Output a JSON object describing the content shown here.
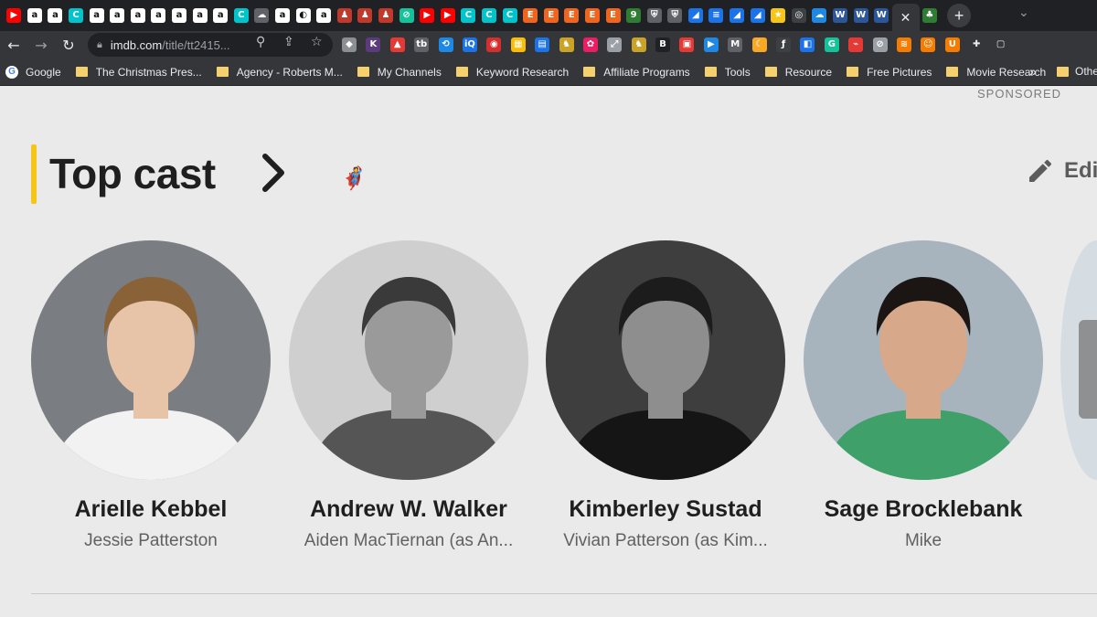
{
  "browser": {
    "tabs": [
      {
        "icon": "youtube-icon",
        "color": "#ff0000",
        "glyph": "▶"
      },
      {
        "icon": "amazon-icon",
        "color": "#ffffff",
        "glyph": "a"
      },
      {
        "icon": "amazon-icon",
        "color": "#ffffff",
        "glyph": "a"
      },
      {
        "icon": "canva-icon",
        "color": "#00c4cc",
        "glyph": "C"
      },
      {
        "icon": "amazon-icon",
        "color": "#ffffff",
        "glyph": "a"
      },
      {
        "icon": "amazon-icon",
        "color": "#ffffff",
        "glyph": "a"
      },
      {
        "icon": "amazon-icon",
        "color": "#ffffff",
        "glyph": "a"
      },
      {
        "icon": "amazon-icon",
        "color": "#ffffff",
        "glyph": "a"
      },
      {
        "icon": "amazon-icon",
        "color": "#ffffff",
        "glyph": "a"
      },
      {
        "icon": "amazon-icon",
        "color": "#ffffff",
        "glyph": "a"
      },
      {
        "icon": "amazon-icon",
        "color": "#ffffff",
        "glyph": "a"
      },
      {
        "icon": "canva-icon",
        "color": "#00c4cc",
        "glyph": "C"
      },
      {
        "icon": "cloud-icon",
        "color": "#5f6368",
        "glyph": "☁"
      },
      {
        "icon": "amazon-icon",
        "color": "#ffffff",
        "glyph": "a"
      },
      {
        "icon": "globe-icon",
        "color": "#ffffff",
        "glyph": "◐"
      },
      {
        "icon": "amazon-icon",
        "color": "#ffffff",
        "glyph": "a"
      },
      {
        "icon": "avatar-icon",
        "color": "#c0392b",
        "glyph": "♟"
      },
      {
        "icon": "avatar-icon",
        "color": "#c0392b",
        "glyph": "♟"
      },
      {
        "icon": "avatar-icon",
        "color": "#c0392b",
        "glyph": "♟"
      },
      {
        "icon": "grammar-icon",
        "color": "#15c39a",
        "glyph": "⊘"
      },
      {
        "icon": "youtube-icon",
        "color": "#ff0000",
        "glyph": "▶"
      },
      {
        "icon": "youtube-icon",
        "color": "#ff0000",
        "glyph": "▶"
      },
      {
        "icon": "canva-icon",
        "color": "#00c4cc",
        "glyph": "C"
      },
      {
        "icon": "canva-icon",
        "color": "#00c4cc",
        "glyph": "C"
      },
      {
        "icon": "canva-icon",
        "color": "#00c4cc",
        "glyph": "C"
      },
      {
        "icon": "etsy-icon",
        "color": "#f1641e",
        "glyph": "E"
      },
      {
        "icon": "etsy-icon",
        "color": "#f1641e",
        "glyph": "E"
      },
      {
        "icon": "etsy-icon",
        "color": "#f1641e",
        "glyph": "E"
      },
      {
        "icon": "etsy-icon",
        "color": "#f1641e",
        "glyph": "E"
      },
      {
        "icon": "etsy-icon",
        "color": "#f1641e",
        "glyph": "E"
      },
      {
        "icon": "shield-icon",
        "color": "#2e7d32",
        "glyph": "9"
      },
      {
        "icon": "shield-icon",
        "color": "#5f6368",
        "glyph": "⛨"
      },
      {
        "icon": "shield-icon",
        "color": "#5f6368",
        "glyph": "⛨"
      },
      {
        "icon": "chart-icon",
        "color": "#1a73e8",
        "glyph": "◢"
      },
      {
        "icon": "doc-icon",
        "color": "#1a73e8",
        "glyph": "≡"
      },
      {
        "icon": "chart-icon",
        "color": "#1a73e8",
        "glyph": "◢"
      },
      {
        "icon": "chart-icon",
        "color": "#1a73e8",
        "glyph": "◢"
      },
      {
        "icon": "star-icon",
        "color": "#f5c518",
        "glyph": "★"
      },
      {
        "icon": "target-icon",
        "color": "#3c4043",
        "glyph": "◎"
      },
      {
        "icon": "onedrive-icon",
        "color": "#1e88e5",
        "glyph": "☁"
      },
      {
        "icon": "word-icon",
        "color": "#2b579a",
        "glyph": "W"
      },
      {
        "icon": "word-icon",
        "color": "#2b579a",
        "glyph": "W"
      },
      {
        "icon": "word-icon",
        "color": "#2b579a",
        "glyph": "W"
      }
    ],
    "active_tab_close": "✕",
    "last_tab": {
      "icon": "imdb-tab-icon",
      "color": "#2e7d32",
      "glyph": "♣"
    },
    "new_tab": "+",
    "window_controls": [
      "⌄",
      "—",
      "❐"
    ],
    "nav": {
      "back": "←",
      "forward": "→",
      "reload": "↻"
    },
    "url_main": "imdb.com",
    "url_rest": "/title/tt2415...",
    "omnibox_icons": [
      {
        "name": "zoom-icon",
        "glyph": "⚲"
      },
      {
        "name": "share-icon",
        "glyph": "⇪"
      },
      {
        "name": "bookmark-star-icon",
        "glyph": "☆"
      }
    ],
    "extensions": [
      {
        "icon": "tag-icon",
        "color": "#8a8f94",
        "glyph": "◆"
      },
      {
        "icon": "keyword-icon",
        "color": "#5b3a7d",
        "glyph": "K"
      },
      {
        "icon": "chart-ext-icon",
        "color": "#e53935",
        "glyph": "▲"
      },
      {
        "icon": "tubebuddy-icon",
        "color": "#5f6368",
        "glyph": "tb"
      },
      {
        "icon": "link-icon",
        "color": "#1e88e5",
        "glyph": "⟲"
      },
      {
        "icon": "vidiq-icon",
        "color": "#1a73e8",
        "glyph": "iQ"
      },
      {
        "icon": "lastpass-icon",
        "color": "#d32f2f",
        "glyph": "◉"
      },
      {
        "icon": "color-grid-icon",
        "color": "#fbbc04",
        "glyph": "▦"
      },
      {
        "icon": "doc-ext-icon",
        "color": "#1a73e8",
        "glyph": "▤"
      },
      {
        "icon": "eagle-icon",
        "color": "#c9a227",
        "glyph": "♞"
      },
      {
        "icon": "pinwheel-icon",
        "color": "#e91e63",
        "glyph": "✿"
      },
      {
        "icon": "expand-icon",
        "color": "#9aa0a6",
        "glyph": "⤢"
      },
      {
        "icon": "eagle-icon",
        "color": "#c9a227",
        "glyph": "♞"
      },
      {
        "icon": "bs-icon",
        "color": "#202124",
        "glyph": "B"
      },
      {
        "icon": "image-ext-icon",
        "color": "#e53935",
        "glyph": "▣"
      },
      {
        "icon": "play-ext-icon",
        "color": "#1e88e5",
        "glyph": "▶"
      },
      {
        "icon": "mail-icon",
        "color": "#5f6368",
        "glyph": "M"
      },
      {
        "icon": "moon-icon",
        "color": "#f9a825",
        "glyph": "☾"
      },
      {
        "icon": "formula-icon",
        "color": "#3c4043",
        "glyph": "ƒ"
      },
      {
        "icon": "translate-icon",
        "color": "#1a73e8",
        "glyph": "◧"
      },
      {
        "icon": "grammarly-icon",
        "color": "#15c39a",
        "glyph": "G"
      },
      {
        "icon": "pdf-icon",
        "color": "#e53935",
        "glyph": "⌁"
      },
      {
        "icon": "block-icon",
        "color": "#9aa0a6",
        "glyph": "⊘"
      },
      {
        "icon": "rss-icon",
        "color": "#f57c00",
        "glyph": "≋"
      },
      {
        "icon": "honey-icon",
        "color": "#f57c00",
        "glyph": "☺"
      },
      {
        "icon": "ubersuggest-icon",
        "color": "#f57c00",
        "glyph": "U"
      },
      {
        "icon": "puzzle-icon",
        "color": "#e8eaed",
        "glyph": "✚"
      },
      {
        "icon": "sidepanel-icon",
        "color": "#e8eaed",
        "glyph": "▢"
      }
    ],
    "bookmarks": [
      {
        "type": "google",
        "label": "Google"
      },
      {
        "type": "folder",
        "label": "The Christmas Pres..."
      },
      {
        "type": "folder",
        "label": "Agency - Roberts M..."
      },
      {
        "type": "folder",
        "label": "My Channels"
      },
      {
        "type": "folder",
        "label": "Keyword Research"
      },
      {
        "type": "folder",
        "label": "Affiliate Programs"
      },
      {
        "type": "folder",
        "label": "Tools"
      },
      {
        "type": "folder",
        "label": "Resource"
      },
      {
        "type": "folder",
        "label": "Free Pictures"
      },
      {
        "type": "folder",
        "label": "Movie Research"
      }
    ],
    "bookmarks_overflow": "»",
    "other_bookmarks": "Othe"
  },
  "page": {
    "sponsored": "SPONSORED",
    "section_title": "Top cast",
    "edit_label": "Edit",
    "sticker": "🦸",
    "cast": [
      {
        "name": "Arielle Kebbel",
        "role": "Jessie Patterston",
        "photo_bg": "#7a7e82",
        "skin": "#e7c3a7",
        "hair": "#8a6238",
        "shirt": "#f2f2f2"
      },
      {
        "name": "Andrew W. Walker",
        "role": "Aiden MacTiernan (as An...",
        "photo_bg": "#cfcfcf",
        "skin": "#9a9a9a",
        "hair": "#3a3a3a",
        "shirt": "#555555"
      },
      {
        "name": "Kimberley Sustad",
        "role": "Vivian Patterson (as Kim...",
        "photo_bg": "#3e3e3e",
        "skin": "#8e8e8e",
        "hair": "#1c1c1c",
        "shirt": "#151515"
      },
      {
        "name": "Sage Brocklebank",
        "role": "Mike",
        "photo_bg": "#a7b4be",
        "skin": "#d7a889",
        "hair": "#1b1613",
        "shirt": "#3fa06a"
      }
    ]
  }
}
